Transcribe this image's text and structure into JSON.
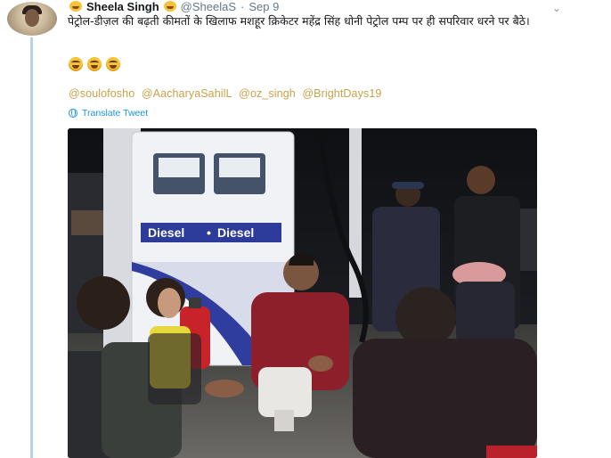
{
  "tweet": {
    "author_name": "Sheela Singh",
    "handle": "@SheelaS",
    "separator": "·",
    "date": "Sep 9",
    "text": "पेट्रोल-डीज़ल की बढ़ती कीमतों के खिलाफ मशहूर क्रिकेटर महेंद्र सिंह धोनी पेट्रोल पम्प पर ही सपरिवार धरने पर बैठे।",
    "emoji_count": 3,
    "emoji_icon": "grinning-face-icon",
    "mentions": [
      "@soulofosho",
      "@AacharyaSahilL",
      "@oz_singh",
      "@BrightDays19"
    ],
    "translate_label": "Translate Tweet",
    "photo": {
      "pump_sign_left": "Diesel",
      "pump_sign_right": "Diesel",
      "pump_sign_dot": "•"
    }
  },
  "colors": {
    "mention": "#c8a24a",
    "translate": "#1b95e0",
    "thread_line": "#b6d2e6"
  }
}
